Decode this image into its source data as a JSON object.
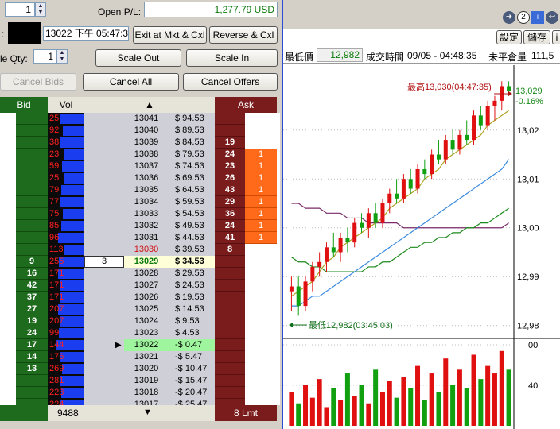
{
  "top": {
    "qty_value": "1",
    "open_pl_label": "Open P/L:",
    "open_pl_value": "1,277.79 USD",
    "time_label": ":",
    "timestamp": "13022 下午 05:47:34",
    "scale_qty_label": "le Qty:",
    "scale_qty_value": "1"
  },
  "buttons": {
    "exit_mkt": "Exit at Mkt & Cxl",
    "reverse": "Reverse & Cxl",
    "scale_out": "Scale Out",
    "scale_in": "Scale In",
    "cancel_bids": "Cancel Bids",
    "cancel_all": "Cancel All",
    "cancel_offers": "Cancel Offers"
  },
  "ladder": {
    "headers": {
      "bid": "Bid",
      "vol": "Vol",
      "ask": "Ask"
    },
    "rows": [
      {
        "bid": "",
        "vol": "25",
        "order": "",
        "price": "13041",
        "pl": "$ 94.53",
        "ask": "",
        "askord": "",
        "vbar": 0.78,
        "kind": "up"
      },
      {
        "bid": "",
        "vol": "92",
        "order": "",
        "price": "13040",
        "pl": "$ 89.53",
        "ask": "",
        "askord": "",
        "vbar": 0.86,
        "kind": "up"
      },
      {
        "bid": "",
        "vol": "38",
        "order": "",
        "price": "13039",
        "pl": "$ 84.53",
        "ask": "19",
        "askord": "",
        "vbar": 0.8,
        "kind": "up"
      },
      {
        "bid": "",
        "vol": "23",
        "order": "",
        "price": "13038",
        "pl": "$ 79.53",
        "ask": "24",
        "askord": "1",
        "vbar": 0.9,
        "kind": "up"
      },
      {
        "bid": "",
        "vol": "59",
        "order": "",
        "price": "13037",
        "pl": "$ 74.53",
        "ask": "23",
        "askord": "1",
        "vbar": 0.84,
        "kind": "up"
      },
      {
        "bid": "",
        "vol": "25",
        "order": "",
        "price": "13036",
        "pl": "$ 69.53",
        "ask": "26",
        "askord": "1",
        "vbar": 0.88,
        "kind": "up"
      },
      {
        "bid": "",
        "vol": "79",
        "order": "",
        "price": "13035",
        "pl": "$ 64.53",
        "ask": "43",
        "askord": "1",
        "vbar": 0.82,
        "kind": "up"
      },
      {
        "bid": "",
        "vol": "77",
        "order": "",
        "price": "13034",
        "pl": "$ 59.53",
        "ask": "29",
        "askord": "1",
        "vbar": 0.8,
        "kind": "up"
      },
      {
        "bid": "",
        "vol": "75",
        "order": "",
        "price": "13033",
        "pl": "$ 54.53",
        "ask": "36",
        "askord": "1",
        "vbar": 0.86,
        "kind": "up"
      },
      {
        "bid": "",
        "vol": "85",
        "order": "",
        "price": "13032",
        "pl": "$ 49.53",
        "ask": "24",
        "askord": "1",
        "vbar": 0.82,
        "kind": "up"
      },
      {
        "bid": "",
        "vol": "96",
        "order": "",
        "price": "13031",
        "pl": "$ 44.53",
        "ask": "41",
        "askord": "1",
        "vbar": 0.74,
        "kind": "up"
      },
      {
        "bid": "",
        "vol": "113",
        "order": "",
        "price": "13030",
        "pl": "$ 39.53",
        "ask": "8",
        "askord": "",
        "vbar": 0.9,
        "kind": "high"
      },
      {
        "bid": "9",
        "vol": "255",
        "order": "3",
        "price": "13029",
        "pl": "$ 34.53",
        "ask": "",
        "askord": "",
        "vbar": 0.76,
        "kind": "last"
      },
      {
        "bid": "16",
        "vol": "171",
        "order": "",
        "price": "13028",
        "pl": "$ 29.53",
        "ask": "",
        "askord": "",
        "vbar": 0.74,
        "kind": "dn"
      },
      {
        "bid": "42",
        "vol": "171",
        "order": "",
        "price": "13027",
        "pl": "$ 24.53",
        "ask": "",
        "askord": "",
        "vbar": 0.8,
        "kind": "dn"
      },
      {
        "bid": "37",
        "vol": "171",
        "order": "",
        "price": "13026",
        "pl": "$ 19.53",
        "ask": "",
        "askord": "",
        "vbar": 0.78,
        "kind": "dn"
      },
      {
        "bid": "27",
        "vol": "207",
        "order": "",
        "price": "13025",
        "pl": "$ 14.53",
        "ask": "",
        "askord": "",
        "vbar": 0.74,
        "kind": "dn"
      },
      {
        "bid": "19",
        "vol": "207",
        "order": "",
        "price": "13024",
        "pl": "$ 9.53",
        "ask": "",
        "askord": "",
        "vbar": 0.8,
        "kind": "dn"
      },
      {
        "bid": "24",
        "vol": "99",
        "order": "",
        "price": "13023",
        "pl": "$ 4.53",
        "ask": "",
        "askord": "",
        "vbar": 0.76,
        "kind": "dn"
      },
      {
        "bid": "17",
        "vol": "144",
        "order": "",
        "price": "13022",
        "pl": "-$ 0.47",
        "ask": "",
        "askord": "",
        "vbar": 0.7,
        "kind": "entry"
      },
      {
        "bid": "14",
        "vol": "176",
        "order": "",
        "price": "13021",
        "pl": "-$ 5.47",
        "ask": "",
        "askord": "",
        "vbar": 0.78,
        "kind": "dn"
      },
      {
        "bid": "13",
        "vol": "269",
        "order": "",
        "price": "13020",
        "pl": "-$ 10.47",
        "ask": "",
        "askord": "",
        "vbar": 0.84,
        "kind": "dn"
      },
      {
        "bid": "",
        "vol": "281",
        "order": "",
        "price": "13019",
        "pl": "-$ 15.47",
        "ask": "",
        "askord": "",
        "vbar": 0.78,
        "kind": "dn"
      },
      {
        "bid": "",
        "vol": "223",
        "order": "",
        "price": "13018",
        "pl": "-$ 20.47",
        "ask": "",
        "askord": "",
        "vbar": 0.82,
        "kind": "dn"
      },
      {
        "bid": "",
        "vol": "224",
        "order": "",
        "price": "13017",
        "pl": "-$ 25.47",
        "ask": "",
        "askord": "",
        "vbar": 0.8,
        "kind": "dn"
      }
    ],
    "footer": {
      "vol_total": "9488",
      "ask_label": "8 Lmt"
    }
  },
  "chart_header": {
    "icon_label": "2",
    "btn_settings": "設定",
    "btn_save": "儲存",
    "btn_clip": "i",
    "low_label": "最低價",
    "low_value": "12,982",
    "time_label": "成交時間",
    "time_value": "09/05 - 04:48:35",
    "open_interest_label": "未平倉量",
    "open_interest_value": "111,5"
  },
  "chart_annot": {
    "high": "最高13,030(04:47:35)",
    "low": "最低12,982(03:45:03)",
    "last_value": "13,029",
    "last_pct": "-0.16%"
  },
  "chart_data": {
    "type": "candlestick",
    "y_ticks": [
      "13,02",
      "13,01",
      "13,00",
      "12,99",
      "12,98"
    ],
    "y_ticks_values": [
      13020,
      13010,
      13000,
      12990,
      12980
    ],
    "ylim": [
      12978,
      13032
    ],
    "volume_ticks": [
      "00",
      "40"
    ],
    "candles": [
      [
        12987,
        12990,
        12983,
        12988
      ],
      [
        12988,
        12990,
        12982,
        12984
      ],
      [
        12984,
        12990,
        12983,
        12989
      ],
      [
        12989,
        12993,
        12987,
        12992
      ],
      [
        12992,
        12995,
        12990,
        12993
      ],
      [
        12993,
        12997,
        12991,
        12996
      ],
      [
        12996,
        12999,
        12994,
        12995
      ],
      [
        12995,
        12999,
        12993,
        12998
      ],
      [
        12998,
        13000,
        12995,
        12997
      ],
      [
        12997,
        13002,
        12996,
        13001
      ],
      [
        13001,
        13003,
        12999,
        13000
      ],
      [
        13000,
        13004,
        12998,
        13003
      ],
      [
        13003,
        13005,
        13000,
        13001
      ],
      [
        13001,
        13006,
        13000,
        13005
      ],
      [
        13005,
        13008,
        13003,
        13007
      ],
      [
        13007,
        13010,
        13005,
        13006
      ],
      [
        13006,
        13011,
        13005,
        13010
      ],
      [
        13010,
        13012,
        13007,
        13008
      ],
      [
        13008,
        13013,
        13007,
        13012
      ],
      [
        13012,
        13014,
        13010,
        13011
      ],
      [
        13011,
        13016,
        13010,
        13015
      ],
      [
        13015,
        13018,
        13013,
        13014
      ],
      [
        13014,
        13019,
        13013,
        13018
      ],
      [
        13018,
        13020,
        13015,
        13016
      ],
      [
        13016,
        13020,
        13015,
        13019
      ],
      [
        13019,
        13022,
        13017,
        13018
      ],
      [
        13018,
        13024,
        13017,
        13023
      ],
      [
        13023,
        13025,
        13020,
        13021
      ],
      [
        13021,
        13026,
        13020,
        13025
      ],
      [
        13025,
        13027,
        13022,
        13026
      ],
      [
        13026,
        13030,
        13024,
        13029
      ],
      [
        13029,
        13030,
        13027,
        13028
      ]
    ],
    "ma_fast": [
      12986,
      12987,
      12988,
      12989,
      12991,
      12993,
      12994,
      12996,
      12997,
      12998,
      12999,
      13000,
      13001,
      13002,
      13004,
      13005,
      13006,
      13007,
      13008,
      13010,
      13011,
      13012,
      13014,
      13015,
      13016,
      13017,
      13018,
      13019,
      13021,
      13022,
      13023,
      13024
    ],
    "ma_mid": [
      12984,
      12984,
      12985,
      12986,
      12986,
      12987,
      12988,
      12989,
      12990,
      12991,
      12992,
      12993,
      12994,
      12995,
      12996,
      12997,
      12998,
      12999,
      13000,
      13001,
      13002,
      13003,
      13004,
      13005,
      13006,
      13007,
      13008,
      13009,
      13010,
      13011,
      13012,
      13014
    ],
    "ma_slow": [
      12994,
      12993,
      12993,
      12992,
      12992,
      12991,
      12991,
      12991,
      12991,
      12991,
      12991,
      12992,
      12992,
      12993,
      12993,
      12994,
      12995,
      12996,
      12996,
      12997,
      12997,
      12998,
      12998,
      12999,
      12999,
      13000,
      13000,
      13001,
      13001,
      13002,
      13003,
      13004
    ],
    "ma_long": [
      13005,
      13005,
      13004,
      13004,
      13004,
      13003,
      13003,
      13003,
      13002,
      13002,
      13002,
      13001,
      13001,
      13001,
      13001,
      13001,
      13000,
      13000,
      13000,
      13000,
      13000,
      13000,
      13000,
      13000,
      13000,
      13000,
      13000,
      13000,
      13000,
      13000,
      13000,
      13001
    ],
    "volumes": [
      18,
      12,
      22,
      15,
      25,
      10,
      20,
      14,
      28,
      16,
      22,
      12,
      30,
      18,
      24,
      15,
      26,
      20,
      32,
      14,
      28,
      18,
      36,
      22,
      30,
      20,
      38,
      25,
      32,
      28,
      40,
      30
    ]
  }
}
